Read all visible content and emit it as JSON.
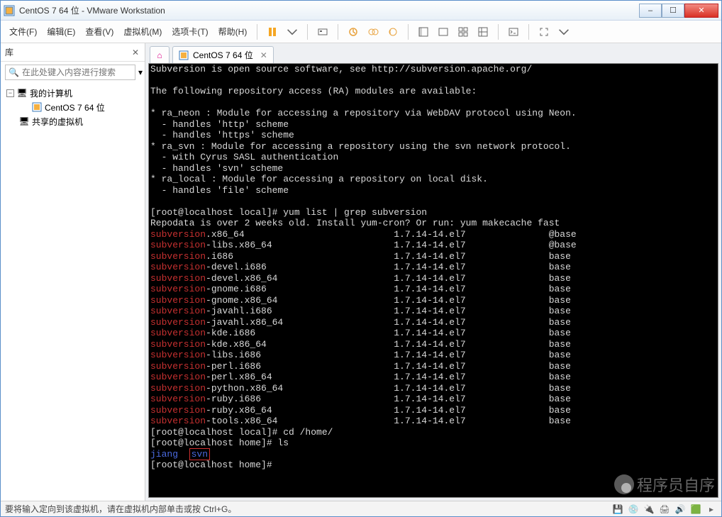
{
  "window": {
    "title": "CentOS 7 64 位 - VMware Workstation",
    "controls": {
      "min": "–",
      "max": "☐",
      "close": "✕"
    }
  },
  "menu": {
    "file": "文件(F)",
    "edit": "编辑(E)",
    "view": "查看(V)",
    "vm": "虚拟机(M)",
    "tabs": "选项卡(T)",
    "help": "帮助(H)"
  },
  "sidebar": {
    "title": "库",
    "close": "✕",
    "search_placeholder": "在此处键入内容进行搜索",
    "dropdown": "▾",
    "tree": {
      "root": "我的计算机",
      "vm": "CentOS 7 64 位",
      "shared": "共享的虚拟机"
    }
  },
  "tabs": {
    "home_icon": "⌂",
    "vm_label": "CentOS 7 64 位",
    "close": "✕"
  },
  "terminal": {
    "lines_top": [
      "Subversion is open source software, see http://subversion.apache.org/",
      "",
      "The following repository access (RA) modules are available:",
      "",
      "* ra_neon : Module for accessing a repository via WebDAV protocol using Neon.",
      "  - handles 'http' scheme",
      "  - handles 'https' scheme",
      "* ra_svn : Module for accessing a repository using the svn network protocol.",
      "  - with Cyrus SASL authentication",
      "  - handles 'svn' scheme",
      "* ra_local : Module for accessing a repository on local disk.",
      "  - handles 'file' scheme",
      "",
      "[root@localhost local]# yum list | grep subversion",
      "Repodata is over 2 weeks old. Install yum-cron? Or run: yum makecache fast"
    ],
    "packages": [
      {
        "name": "subversion",
        "suffix": ".x86_64",
        "ver": "1.7.14-14.el7",
        "repo": "@base"
      },
      {
        "name": "subversion",
        "suffix": "-libs.x86_64",
        "ver": "1.7.14-14.el7",
        "repo": "@base"
      },
      {
        "name": "subversion",
        "suffix": ".i686",
        "ver": "1.7.14-14.el7",
        "repo": "base"
      },
      {
        "name": "subversion",
        "suffix": "-devel.i686",
        "ver": "1.7.14-14.el7",
        "repo": "base"
      },
      {
        "name": "subversion",
        "suffix": "-devel.x86_64",
        "ver": "1.7.14-14.el7",
        "repo": "base"
      },
      {
        "name": "subversion",
        "suffix": "-gnome.i686",
        "ver": "1.7.14-14.el7",
        "repo": "base"
      },
      {
        "name": "subversion",
        "suffix": "-gnome.x86_64",
        "ver": "1.7.14-14.el7",
        "repo": "base"
      },
      {
        "name": "subversion",
        "suffix": "-javahl.i686",
        "ver": "1.7.14-14.el7",
        "repo": "base"
      },
      {
        "name": "subversion",
        "suffix": "-javahl.x86_64",
        "ver": "1.7.14-14.el7",
        "repo": "base"
      },
      {
        "name": "subversion",
        "suffix": "-kde.i686",
        "ver": "1.7.14-14.el7",
        "repo": "base"
      },
      {
        "name": "subversion",
        "suffix": "-kde.x86_64",
        "ver": "1.7.14-14.el7",
        "repo": "base"
      },
      {
        "name": "subversion",
        "suffix": "-libs.i686",
        "ver": "1.7.14-14.el7",
        "repo": "base"
      },
      {
        "name": "subversion",
        "suffix": "-perl.i686",
        "ver": "1.7.14-14.el7",
        "repo": "base"
      },
      {
        "name": "subversion",
        "suffix": "-perl.x86_64",
        "ver": "1.7.14-14.el7",
        "repo": "base"
      },
      {
        "name": "subversion",
        "suffix": "-python.x86_64",
        "ver": "1.7.14-14.el7",
        "repo": "base"
      },
      {
        "name": "subversion",
        "suffix": "-ruby.i686",
        "ver": "1.7.14-14.el7",
        "repo": "base"
      },
      {
        "name": "subversion",
        "suffix": "-ruby.x86_64",
        "ver": "1.7.14-14.el7",
        "repo": "base"
      },
      {
        "name": "subversion",
        "suffix": "-tools.x86_64",
        "ver": "1.7.14-14.el7",
        "repo": "base"
      }
    ],
    "lines_bottom": {
      "cd": "[root@localhost local]# cd /home/",
      "ls": "[root@localhost home]# ls",
      "jiang": "jiang",
      "svn": "svn",
      "prompt": "[root@localhost home]# "
    }
  },
  "statusbar": {
    "message": "要将输入定向到该虚拟机，请在虚拟机内部单击或按 Ctrl+G。"
  },
  "watermark": {
    "text": "程序员自序"
  }
}
